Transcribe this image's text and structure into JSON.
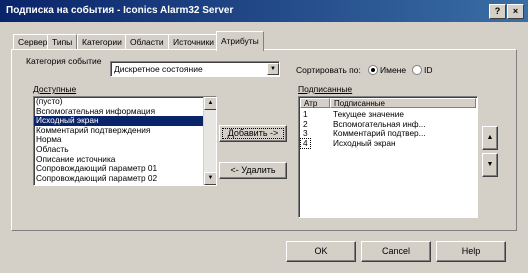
{
  "window": {
    "title": "Подписка на события - Iconics Alarm32 Server",
    "help_btn": "?",
    "close_btn": "×"
  },
  "tabs": [
    {
      "label": "Сервер",
      "active": false
    },
    {
      "label": "Типы",
      "active": false
    },
    {
      "label": "Категории",
      "active": false
    },
    {
      "label": "Области",
      "active": false
    },
    {
      "label": "Источники",
      "active": false
    },
    {
      "label": "Атрибуты",
      "active": true
    }
  ],
  "category": {
    "label": "Категория событие",
    "value": "Дискретное состояние"
  },
  "sort": {
    "label": "Сортировать по:",
    "options": [
      {
        "label": "Именe",
        "selected": true
      },
      {
        "label": "ID",
        "selected": false
      }
    ]
  },
  "available": {
    "label": "Доступные",
    "items": [
      {
        "text": "(пусто)",
        "selected": false
      },
      {
        "text": "Вспомогательная информация",
        "selected": false
      },
      {
        "text": "Исходный экран",
        "selected": true
      },
      {
        "text": "Комментарий подтверждения",
        "selected": false
      },
      {
        "text": "Норма",
        "selected": false
      },
      {
        "text": "Область",
        "selected": false
      },
      {
        "text": "Описание источника",
        "selected": false
      },
      {
        "text": "Сопровождающий параметр 01",
        "selected": false
      },
      {
        "text": "Сопровождающий параметр 02",
        "selected": false
      }
    ]
  },
  "buttons": {
    "add": "Добавить ->",
    "remove": "<- Удалить",
    "ok": "OK",
    "cancel": "Cancel",
    "help": "Help"
  },
  "subscribed": {
    "label": "Подписанные",
    "columns": [
      "Атр",
      "Подписанные"
    ],
    "rows": [
      {
        "attr": "1",
        "name": "Текущее значение"
      },
      {
        "attr": "2",
        "name": "Вспомогательная инф..."
      },
      {
        "attr": "3",
        "name": "Комментарий подтвер..."
      },
      {
        "attr": "4",
        "name": "Исходный экран"
      }
    ]
  }
}
